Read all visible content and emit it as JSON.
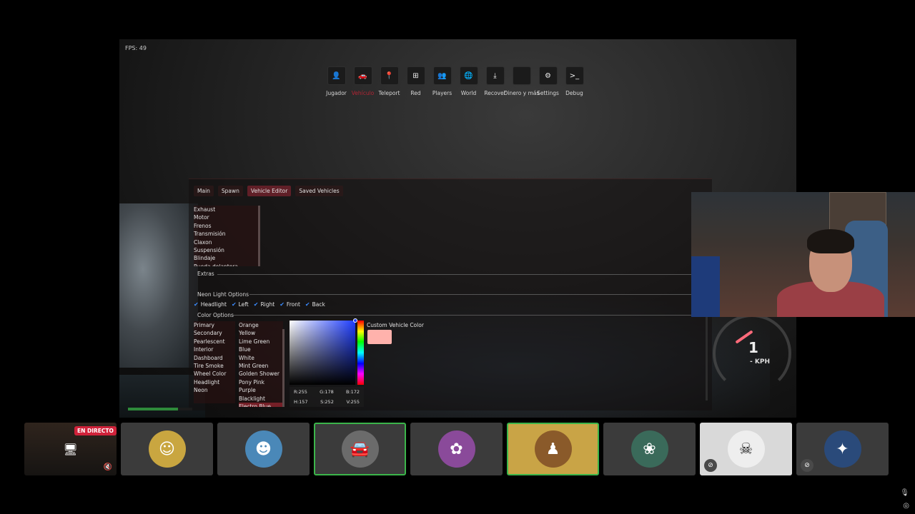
{
  "game": {
    "fps": "FPS: 49",
    "nav": [
      {
        "label": "Jugador",
        "icon": "user-icon",
        "glyph": "👤",
        "active": false
      },
      {
        "label": "Vehículo",
        "icon": "car-icon",
        "glyph": "🚗",
        "active": true
      },
      {
        "label": "Teleport",
        "icon": "map-pin-icon",
        "glyph": "📍",
        "active": false
      },
      {
        "label": "Red",
        "icon": "network-icon",
        "glyph": "⊞",
        "active": false
      },
      {
        "label": "Players",
        "icon": "players-icon",
        "glyph": "👥",
        "active": false
      },
      {
        "label": "World",
        "icon": "globe-icon",
        "glyph": "🌐",
        "active": false
      },
      {
        "label": "Recover",
        "icon": "recover-icon",
        "glyph": "⤓",
        "active": false
      },
      {
        "label": "Dinero y más",
        "icon": "money-icon",
        "glyph": "",
        "active": false
      },
      {
        "label": "Settings",
        "icon": "gear-icon",
        "glyph": "⚙",
        "active": false
      },
      {
        "label": "Debug",
        "icon": "terminal-icon",
        "glyph": ">_",
        "active": false
      }
    ],
    "tabs": [
      {
        "label": "Main",
        "active": false
      },
      {
        "label": "Spawn",
        "active": false
      },
      {
        "label": "Vehicle Editor",
        "active": true
      },
      {
        "label": "Saved Vehicles",
        "active": false
      }
    ],
    "parts": [
      "Exhaust",
      "Motor",
      "Frenos",
      "Transmisión",
      "Claxon",
      "Suspensión",
      "Blindaje",
      "Rueda delantera"
    ],
    "sections": {
      "extras": "Extras",
      "neon": "Neon Light Options",
      "color": "Color Options"
    },
    "neon_options": [
      "Headlight",
      "Left",
      "Right",
      "Front",
      "Back"
    ],
    "color_targets": [
      "Primary",
      "Secondary",
      "Pearlescent",
      "Interior",
      "Dashboard",
      "Tire Smoke",
      "Wheel Color",
      "Headlight",
      "Neon"
    ],
    "color_names": [
      "Orange",
      "Yellow",
      "Lime Green",
      "Blue",
      "White",
      "Mint Green",
      "Golden Shower",
      "Pony Pink",
      "Purple",
      "Blacklight",
      "Electro Blue"
    ],
    "selected_color": "Electro Blue",
    "picker": {
      "r": "R:255",
      "g": "G:178",
      "b": "B:172",
      "h": "H:157",
      "s": "S:252",
      "v": "V:255",
      "custom_label": "Custom Vehicle Color",
      "swatch": "#ffb2ac"
    },
    "speedo": {
      "gear": "1",
      "unit": "- KPH"
    }
  },
  "call": {
    "live_badge": "EN DIRECTO",
    "tiles": [
      {
        "avatar_color": "#c9a640",
        "glyph": "☺",
        "speaking": false
      },
      {
        "avatar_color": "#4a88b8",
        "glyph": "☻",
        "speaking": false
      },
      {
        "avatar_color": "#6b6b6b",
        "glyph": "🚘",
        "speaking": true
      },
      {
        "avatar_color": "#8a4a9a",
        "glyph": "✿",
        "speaking": false
      },
      {
        "avatar_color": "#8a5a2a",
        "glyph": "♟",
        "speaking": true
      },
      {
        "avatar_color": "#3a6a5a",
        "glyph": "❀",
        "speaking": false
      },
      {
        "avatar_color": "#eeeeee",
        "glyph": "☠",
        "speaking": false
      },
      {
        "avatar_color": "#2a4a7a",
        "glyph": "✦",
        "speaking": false
      }
    ]
  },
  "colors": {
    "accent": "#b22434",
    "speaking": "#3bb54a",
    "live": "#d0223a"
  }
}
